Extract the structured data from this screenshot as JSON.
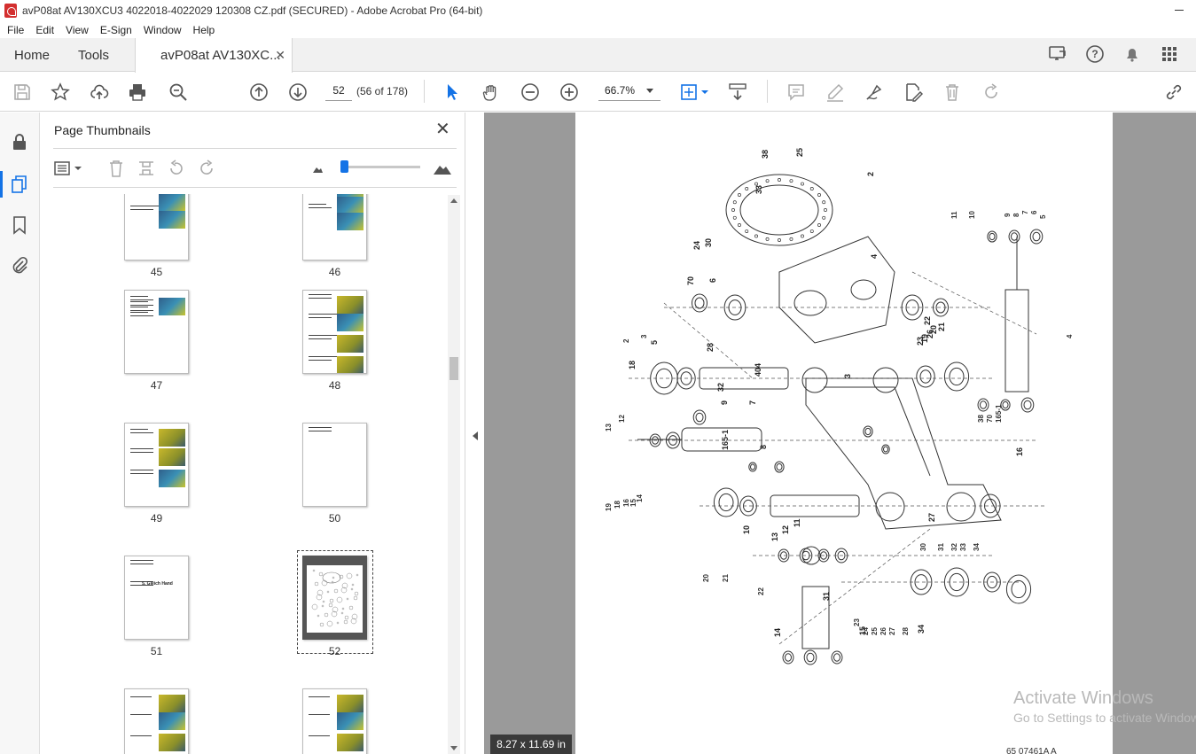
{
  "window": {
    "title": "avP08at AV130XCU3 4022018-4022029 120308 CZ.pdf (SECURED) - Adobe Acrobat Pro (64-bit)"
  },
  "menu": [
    "File",
    "Edit",
    "View",
    "E-Sign",
    "Window",
    "Help"
  ],
  "tabs": {
    "home": "Home",
    "tools": "Tools",
    "document": "avP08at AV130XC..."
  },
  "toolbar": {
    "page_number": "52",
    "page_count": "(56 of 178)",
    "zoom": "66.7%"
  },
  "thumbnails_panel": {
    "title": "Page Thumbnails",
    "slider_level": 0.05,
    "pages": [
      {
        "label": "45"
      },
      {
        "label": "46"
      },
      {
        "label": "47"
      },
      {
        "label": "48"
      },
      {
        "label": "49"
      },
      {
        "label": "50"
      },
      {
        "label": "51",
        "heading": "5. Gleich Hand"
      },
      {
        "label": "52"
      }
    ]
  },
  "document": {
    "page_size": "8.27 x 11.69 in",
    "footer_code": "65 07461A A",
    "part_numbers": [
      "2",
      "3",
      "4",
      "5",
      "6",
      "7",
      "8",
      "9",
      "10",
      "11",
      "12",
      "13",
      "14",
      "15",
      "16",
      "18",
      "19",
      "20",
      "21",
      "22",
      "23",
      "24",
      "25",
      "26",
      "27",
      "28",
      "30",
      "31",
      "32",
      "33",
      "34",
      "38",
      "70",
      "165-1",
      "404"
    ]
  },
  "watermark": {
    "line1": "Activate Windows",
    "line2": "Go to Settings to activate Windows."
  },
  "colors": {
    "accent": "#1473e6",
    "doc_background": "#9a9a9a",
    "pdf_red": "#d32f2f"
  }
}
